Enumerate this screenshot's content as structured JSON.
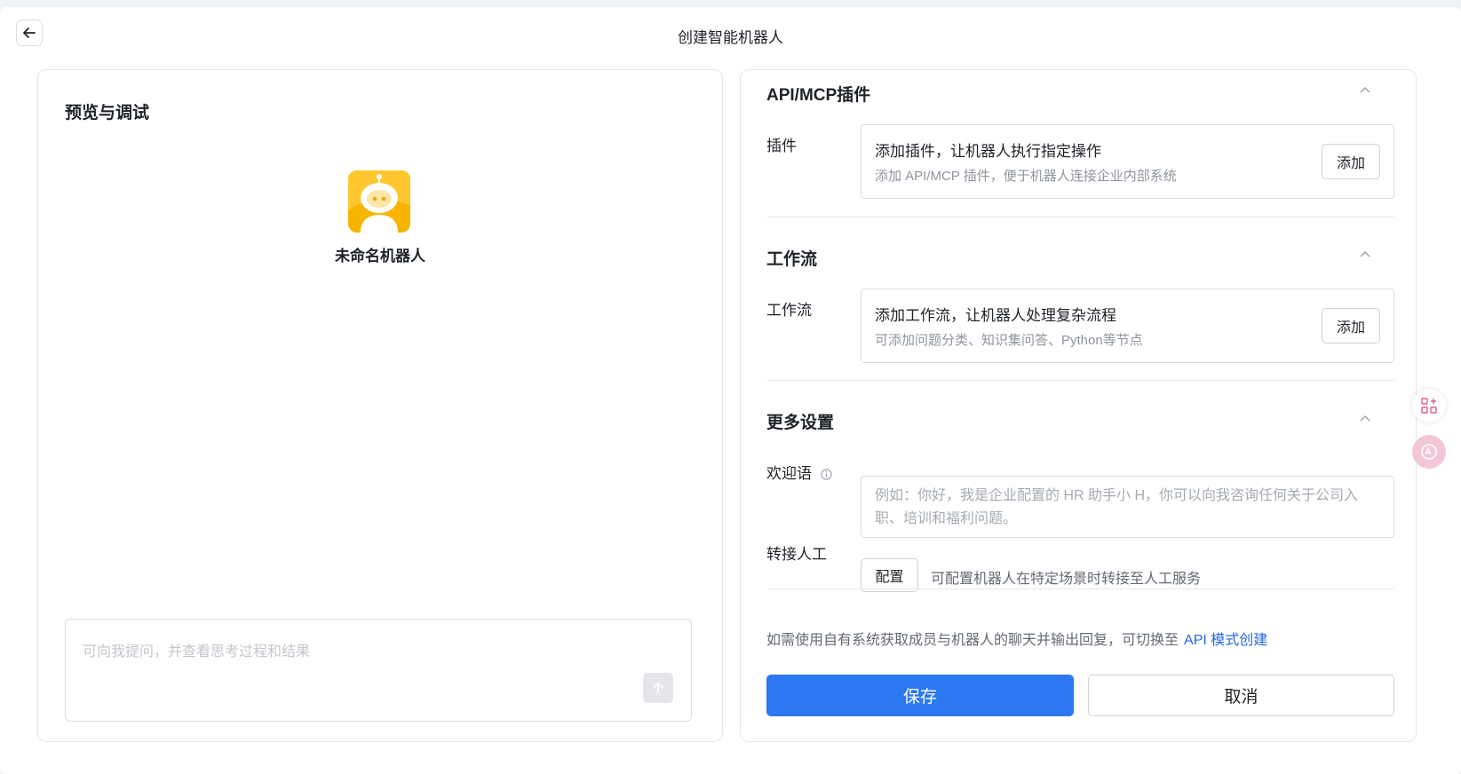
{
  "header": {
    "title": "创建智能机器人"
  },
  "preview": {
    "title": "预览与调试",
    "bot_name": "未命名机器人",
    "chat_placeholder": "可向我提问，并查看思考过程和结果"
  },
  "plugins": {
    "section_title": "API/MCP插件",
    "label": "插件",
    "card_title": "添加插件，让机器人执行指定操作",
    "card_desc": "添加 API/MCP 插件，便于机器人连接企业内部系统",
    "add_label": "添加"
  },
  "workflow": {
    "section_title": "工作流",
    "label": "工作流",
    "card_title": "添加工作流，让机器人处理复杂流程",
    "card_desc": "可添加问题分类、知识集问答、Python等节点",
    "add_label": "添加"
  },
  "more": {
    "section_title": "更多设置",
    "welcome_label": "欢迎语",
    "welcome_placeholder": "例如：你好，我是企业配置的 HR 助手小 H，你可以向我咨询任何关于公司入职、培训和福利问题。",
    "handoff_label": "转接人工",
    "handoff_button": "配置",
    "handoff_desc": "可配置机器人在特定场景时转接至人工服务"
  },
  "footer": {
    "api_note": "如需使用自有系统获取成员与机器人的聊天并输出回复，可切换至",
    "api_link": "API 模式创建",
    "save_label": "保存",
    "cancel_label": "取消"
  },
  "colors": {
    "primary": "#2b78f0",
    "link": "#2266e3",
    "avatar": "#f7b500",
    "float_tool": "#f3c6d6"
  },
  "icons": {
    "back": "arrow-left-icon",
    "send": "arrow-up-icon",
    "collapse": "chevron-up-icon",
    "info": "info-circle-icon",
    "apps": "apps-grid-icon",
    "translate": "translate-icon"
  }
}
